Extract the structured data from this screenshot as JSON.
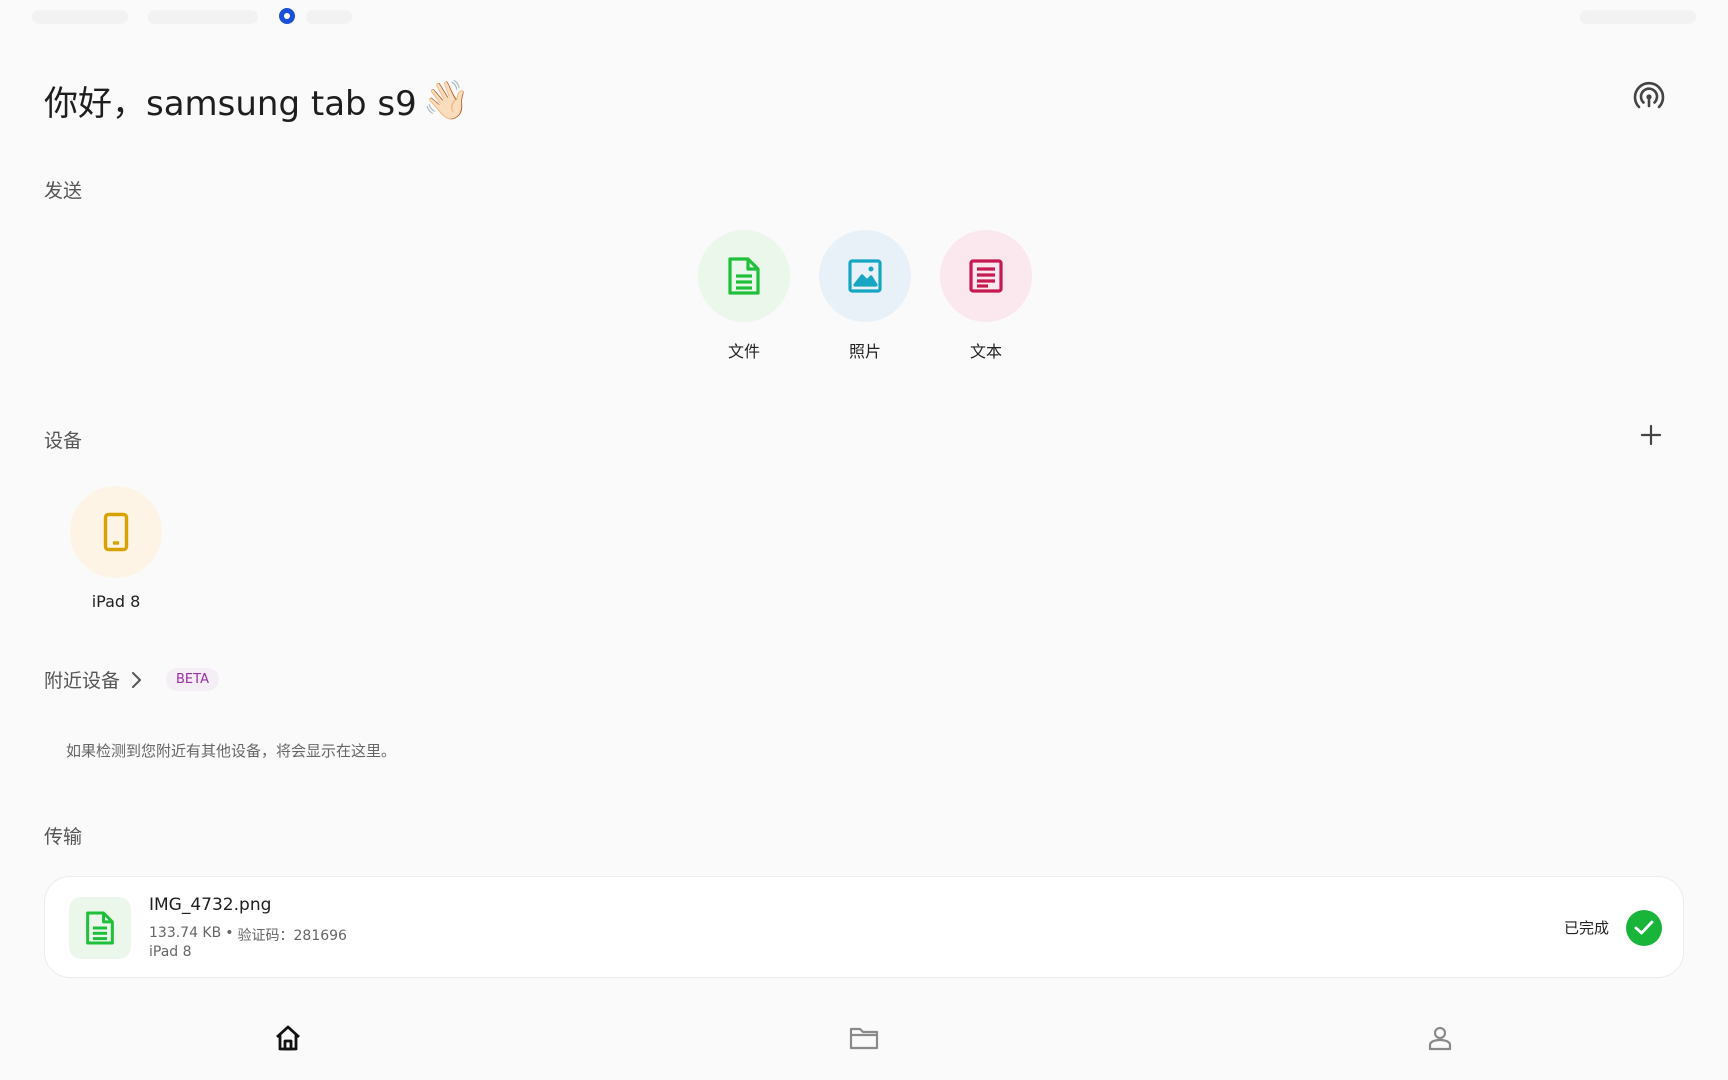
{
  "greeting": {
    "text": "你好，samsung tab s9",
    "emoji": "👋🏻"
  },
  "icons": {
    "radar": "radar-icon",
    "plus": "plus-icon",
    "check": "check-icon"
  },
  "sections": {
    "send": "发送",
    "devices": "设备",
    "nearby": "附近设备",
    "transfers": "传输"
  },
  "send_options": [
    {
      "label": "文件",
      "icon": "file-icon",
      "color": "#1fbf3a",
      "bg": "#eaf7ea"
    },
    {
      "label": "照片",
      "icon": "image-icon",
      "color": "#16a6c4",
      "bg": "#e8f1f8"
    },
    {
      "label": "文本",
      "icon": "text-icon",
      "color": "#c61a52",
      "bg": "#fbe8ee"
    }
  ],
  "devices": [
    {
      "label": "iPad 8",
      "icon": "phone-icon",
      "color": "#d9a200"
    }
  ],
  "nearby": {
    "badge": "BETA",
    "hint": "如果检测到您附近有其他设备，将会显示在这里。"
  },
  "transfers": [
    {
      "file_name": "IMG_4732.png",
      "size": "133.74 KB",
      "separator": "•",
      "code": "验证码：281696",
      "device": "iPad 8",
      "status": "已完成",
      "status_color": "#19b53a"
    }
  ],
  "nav": [
    {
      "icon": "home-icon",
      "active": true
    },
    {
      "icon": "folder-icon",
      "active": false
    },
    {
      "icon": "user-icon",
      "active": false
    }
  ]
}
